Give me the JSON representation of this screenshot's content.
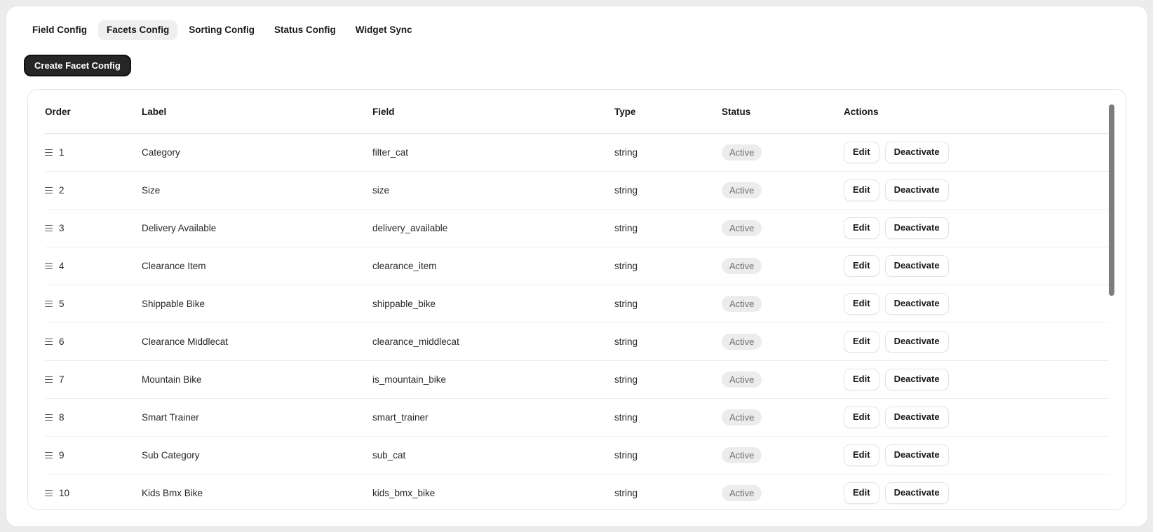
{
  "tabs": [
    {
      "label": "Field Config",
      "active": false
    },
    {
      "label": "Facets Config",
      "active": true
    },
    {
      "label": "Sorting Config",
      "active": false
    },
    {
      "label": "Status Config",
      "active": false
    },
    {
      "label": "Widget Sync",
      "active": false
    }
  ],
  "create_button": {
    "label": "Create Facet Config"
  },
  "table": {
    "columns": [
      "Order",
      "Label",
      "Field",
      "Type",
      "Status",
      "Actions"
    ],
    "row_actions": {
      "edit": "Edit",
      "deactivate": "Deactivate"
    },
    "rows": [
      {
        "order": "1",
        "label": "Category",
        "field": "filter_cat",
        "type": "string",
        "status": "Active"
      },
      {
        "order": "2",
        "label": "Size",
        "field": "size",
        "type": "string",
        "status": "Active"
      },
      {
        "order": "3",
        "label": "Delivery Available",
        "field": "delivery_available",
        "type": "string",
        "status": "Active"
      },
      {
        "order": "4",
        "label": "Clearance Item",
        "field": "clearance_item",
        "type": "string",
        "status": "Active"
      },
      {
        "order": "5",
        "label": "Shippable Bike",
        "field": "shippable_bike",
        "type": "string",
        "status": "Active"
      },
      {
        "order": "6",
        "label": "Clearance Middlecat",
        "field": "clearance_middlecat",
        "type": "string",
        "status": "Active"
      },
      {
        "order": "7",
        "label": "Mountain Bike",
        "field": "is_mountain_bike",
        "type": "string",
        "status": "Active"
      },
      {
        "order": "8",
        "label": "Smart Trainer",
        "field": "smart_trainer",
        "type": "string",
        "status": "Active"
      },
      {
        "order": "9",
        "label": "Sub Category",
        "field": "sub_cat",
        "type": "string",
        "status": "Active"
      },
      {
        "order": "10",
        "label": "Kids Bmx Bike",
        "field": "kids_bmx_bike",
        "type": "string",
        "status": "Active"
      }
    ]
  },
  "colors": {
    "page_background": "#ececec",
    "accent_dark": "#262626",
    "active_tab_background": "#efefef",
    "badge_background": "#ececec",
    "badge_text": "#6f6f76",
    "scrollbar_thumb": "#7d7d7d"
  }
}
